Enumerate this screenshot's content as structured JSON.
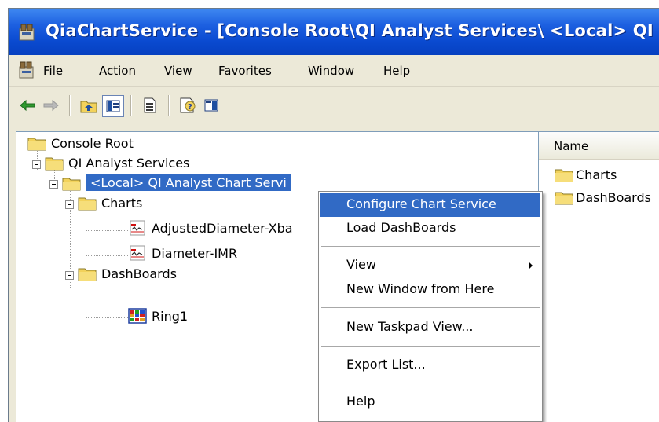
{
  "window": {
    "title": "QiaChartService - [Console Root\\QI Analyst Services\\ <Local> QI Analy"
  },
  "menubar": {
    "items": [
      "File",
      "Action",
      "View",
      "Favorites",
      "Window",
      "Help"
    ]
  },
  "toolbar": {
    "icons": [
      "back-arrow-icon",
      "forward-arrow-icon",
      "up-one-level-icon",
      "show-hide-tree-icon",
      "export-list-icon",
      "help-icon",
      "show-hide-action-pane-icon"
    ]
  },
  "tree": {
    "console_root": "Console Root",
    "qi_services": "QI Analyst Services",
    "local_service": "<Local> QI Analyst Chart Servi",
    "charts": "Charts",
    "chart_1": "AdjustedDiameter-Xba",
    "chart_2": "Diameter-IMR",
    "dashboards": "DashBoards",
    "dashboard_1": "Ring1"
  },
  "list": {
    "column_name": "Name",
    "rows": [
      "Charts",
      "DashBoards"
    ]
  },
  "context_menu": {
    "configure": "Configure Chart Service",
    "load_dashboards": "Load DashBoards",
    "view": "View",
    "new_window": "New Window from Here",
    "new_taskpad": "New Taskpad View...",
    "export_list": "Export List...",
    "help": "Help"
  },
  "colors": {
    "title_bar": "#0a4ad0",
    "selection": "#316ac5",
    "folder": "#f2d25b"
  }
}
